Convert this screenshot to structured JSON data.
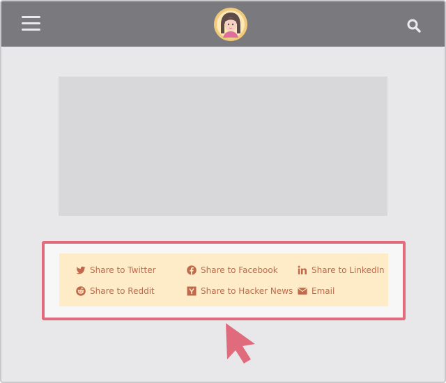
{
  "header": {
    "menu_icon": "hamburger-menu-icon",
    "avatar_icon": "user-avatar-icon",
    "search_icon": "search-icon",
    "bar_color": "#7a797d"
  },
  "share": {
    "items": [
      {
        "label": "Share to Twitter",
        "icon": "twitter-icon"
      },
      {
        "label": "Share to Facebook",
        "icon": "facebook-icon"
      },
      {
        "label": "Share to LinkedIn",
        "icon": "linkedin-icon"
      },
      {
        "label": "Share to Reddit",
        "icon": "reddit-icon"
      },
      {
        "label": "Share to Hacker News",
        "icon": "hacker-news-icon"
      },
      {
        "label": "Email",
        "icon": "email-icon"
      }
    ],
    "text_color": "#bf6a4d",
    "panel_color": "#feebc7",
    "highlight_color": "#e06b7d"
  },
  "pointer_icon": "mouse-pointer-icon"
}
